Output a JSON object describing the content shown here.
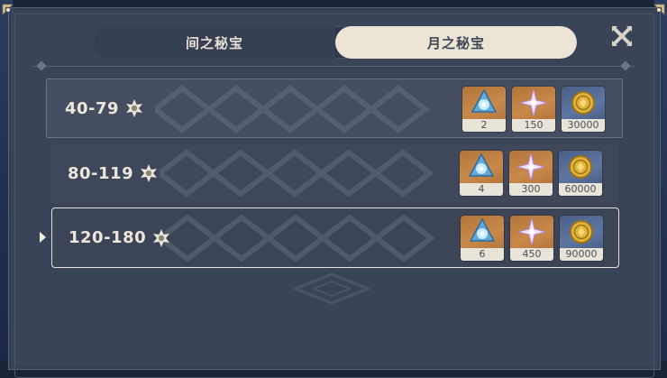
{
  "tabs": [
    {
      "label": "间之秘宝",
      "active": false
    },
    {
      "label": "月之秘宝",
      "active": true
    }
  ],
  "rows": [
    {
      "range": "40-79",
      "selected": false,
      "rewards": [
        {
          "icon": "blue-orb-icon",
          "count": "2"
        },
        {
          "icon": "star-crystal-icon",
          "count": "150"
        },
        {
          "icon": "gold-coin-icon",
          "count": "30000"
        }
      ]
    },
    {
      "range": "80-119",
      "selected": false,
      "rewards": [
        {
          "icon": "blue-orb-icon",
          "count": "4"
        },
        {
          "icon": "star-crystal-icon",
          "count": "300"
        },
        {
          "icon": "gold-coin-icon",
          "count": "60000"
        }
      ]
    },
    {
      "range": "120-180",
      "selected": true,
      "rewards": [
        {
          "icon": "blue-orb-icon",
          "count": "6"
        },
        {
          "icon": "star-crystal-icon",
          "count": "450"
        },
        {
          "icon": "gold-coin-icon",
          "count": "90000"
        }
      ]
    }
  ],
  "colors": {
    "panel": "#3a4459",
    "tab_active_bg": "#ece5d6",
    "tab_inactive_text": "#e6e0d2",
    "item_orange": "#c9894a",
    "item_blue": "#5d76a2",
    "count_strip": "#e9e4d8",
    "selected_border": "#e9e4d8"
  }
}
